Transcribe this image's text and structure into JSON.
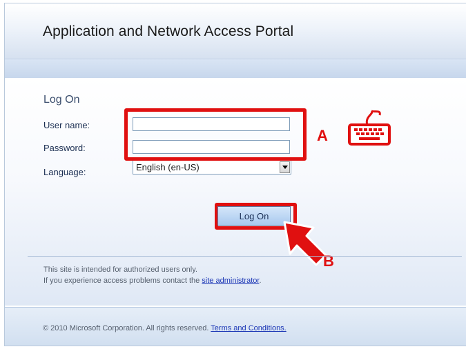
{
  "header": {
    "title": "Application and Network Access Portal"
  },
  "form": {
    "heading": "Log On",
    "username_label": "User name:",
    "username_value": "",
    "password_label": "Password:",
    "password_value": "",
    "language_label": "Language:",
    "language_selected": "English (en-US)",
    "submit_label": "Log On"
  },
  "annotations": {
    "a": "A",
    "b": "B"
  },
  "notice": {
    "line1": "This site is intended for authorized users only.",
    "line2_prefix": "If you experience access problems contact the ",
    "line2_link": "site administrator",
    "line2_suffix": "."
  },
  "footer": {
    "copyright": "© 2010 Microsoft Corporation. All rights reserved. ",
    "terms_link": "Terms and Conditions."
  },
  "icons": {
    "keyboard": "keyboard-icon",
    "arrow": "pointer-arrow-icon",
    "dropdown": "chevron-down-icon"
  },
  "colors": {
    "annotation_red": "#e01010",
    "link_blue": "#1a35b5",
    "heading": "#3c4f6e"
  }
}
